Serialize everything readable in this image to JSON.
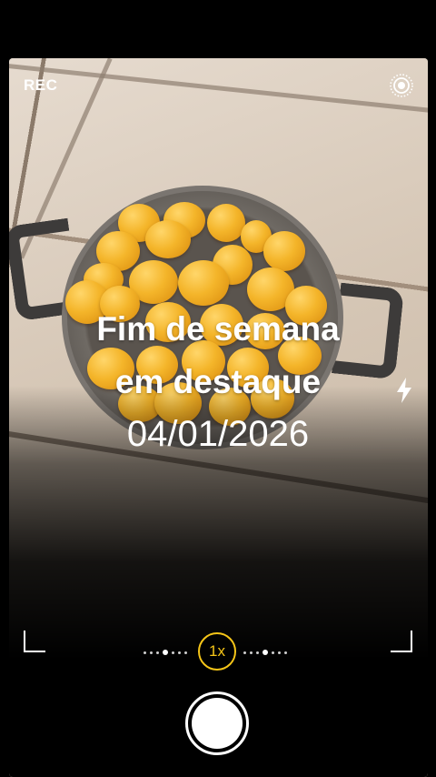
{
  "status": {
    "rec_label": "REC"
  },
  "overlay": {
    "title_line1": "Fim de semana",
    "title_line2": "em destaque",
    "date": "04/01/2026"
  },
  "controls": {
    "zoom_label": "1x",
    "icons": [
      "live-photo-icon",
      "flash-icon",
      "shutter-button",
      "frame-corner-icon"
    ]
  },
  "colors": {
    "accent": "#f5c518",
    "background": "#000000"
  }
}
